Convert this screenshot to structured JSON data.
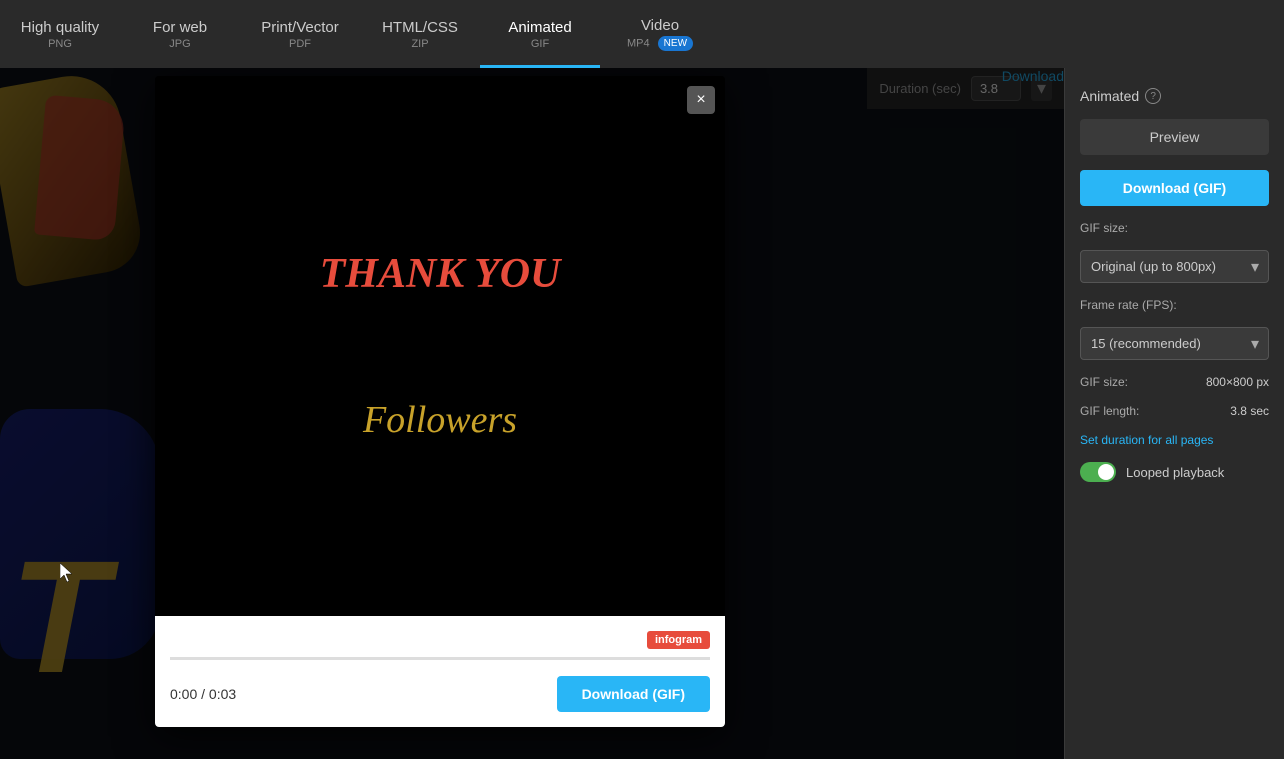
{
  "nav": {
    "tabs": [
      {
        "label": "High quality",
        "sub": "PNG",
        "active": false
      },
      {
        "label": "For web",
        "sub": "JPG",
        "active": false
      },
      {
        "label": "Print/Vector",
        "sub": "PDF",
        "active": false
      },
      {
        "label": "HTML/CSS",
        "sub": "ZIP",
        "active": false
      },
      {
        "label": "Animated",
        "sub": "GIF",
        "active": true
      },
      {
        "label": "Video",
        "sub": "MP4",
        "active": false,
        "badge": "New"
      }
    ]
  },
  "right_panel": {
    "title": "Animated",
    "preview_btn": "Preview",
    "download_btn": "Download (GIF)",
    "gif_size_label": "GIF size:",
    "gif_size_option": "Original (up to 800px)",
    "frame_rate_label": "Frame rate (FPS):",
    "frame_rate_option": "15 (recommended)",
    "size_label": "GIF size:",
    "size_value": "800×800 px",
    "length_label": "GIF length:",
    "length_value": "3.8 sec",
    "set_duration_link": "Set duration for all pages",
    "looped_label": "Looped playback"
  },
  "modal": {
    "close_label": "×",
    "thank_you_text": "THANK YOU",
    "followers_text": "Followers",
    "infogram_badge": "infogram",
    "time_current": "0:00",
    "time_total": "0:03",
    "download_btn": "Download (GIF)",
    "progress_pct": 0
  },
  "duration": {
    "label": "Duration (sec)",
    "value": "3.8"
  },
  "download_partial": "Download"
}
